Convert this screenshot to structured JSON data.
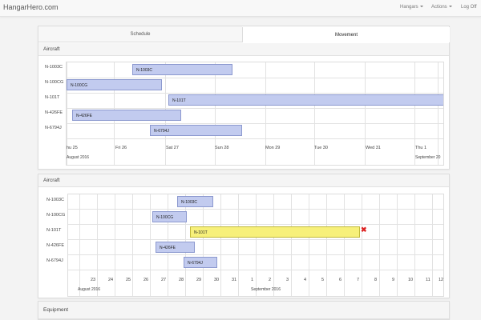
{
  "navbar": {
    "brand": "HangarHero.com",
    "items": [
      {
        "label": "Hangars",
        "caret": true
      },
      {
        "label": "Actions",
        "caret": true
      },
      {
        "label": "Log Off",
        "caret": false
      }
    ]
  },
  "tabs": [
    {
      "label": "Schedule",
      "active": false
    },
    {
      "label": "Movement",
      "active": true
    }
  ],
  "schedule_section": {
    "title": "Aircraft",
    "rows": [
      "N-1003C",
      "N-100CG",
      "N-101T",
      "N-426FE",
      "N-6794J"
    ],
    "day_ticks": [
      "hu 25",
      "Fri 26",
      "Sat 27",
      "Sun 28",
      "Mon 29",
      "Tue 30",
      "Wed 31",
      "Thu 1"
    ],
    "months": [
      "August 2016",
      "September 20"
    ],
    "bars": [
      {
        "row": 0,
        "label": "N-1003C"
      },
      {
        "row": 1,
        "label": "N-100CG"
      },
      {
        "row": 2,
        "label": "N-101T"
      },
      {
        "row": 3,
        "label": "N-426FE"
      },
      {
        "row": 4,
        "label": "N-6794J"
      }
    ]
  },
  "movement_section": {
    "title": "Aircraft",
    "rows": [
      "N-1003C",
      "N-100CG",
      "N-101T",
      "N-426FE",
      "N-6794J"
    ],
    "day_ticks": [
      "23",
      "24",
      "25",
      "26",
      "27",
      "28",
      "29",
      "30",
      "31",
      "1",
      "2",
      "3",
      "4",
      "5",
      "6",
      "7",
      "8",
      "9",
      "10",
      "11",
      "12"
    ],
    "months": [
      "August 2016",
      "September 2016"
    ],
    "bars": [
      {
        "row": 0,
        "label": "N-1003C",
        "highlight": false
      },
      {
        "row": 1,
        "label": "N-100CG",
        "highlight": false
      },
      {
        "row": 2,
        "label": "N-101T",
        "highlight": true
      },
      {
        "row": 3,
        "label": "N-426FE",
        "highlight": false
      },
      {
        "row": 4,
        "label": "N-6794J",
        "highlight": false
      }
    ],
    "remove_icon": "close-icon"
  },
  "equipment_section": {
    "title": "Equipment"
  },
  "colors": {
    "bar_fill": "#c2cbef",
    "bar_border": "#8c99cf",
    "highlight_fill": "#f7f07a",
    "remove_icon": "#dd2222"
  }
}
